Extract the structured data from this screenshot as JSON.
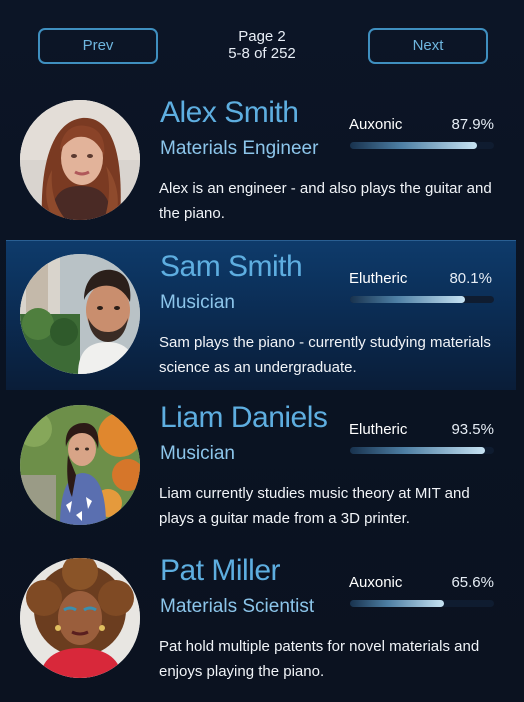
{
  "pagination": {
    "prev_label": "Prev",
    "next_label": "Next",
    "page_label": "Page 2",
    "range_label": "5-8 of 252"
  },
  "people": [
    {
      "name": "Alex Smith",
      "role": "Materials Engineer",
      "skill": "Auxonic",
      "percent_label": "87.9%",
      "percent": 87.9,
      "bio": "Alex is an engineer - and also plays the guitar and the piano.",
      "selected": false
    },
    {
      "name": "Sam Smith",
      "role": "Musician",
      "skill": "Elutheric",
      "percent_label": "80.1%",
      "percent": 80.1,
      "bio": "Sam plays the piano - currently studying materials science as an undergraduate.",
      "selected": true
    },
    {
      "name": "Liam Daniels",
      "role": "Musician",
      "skill": "Elutheric",
      "percent_label": "93.5%",
      "percent": 93.5,
      "bio": "Liam currently studies music theory at MIT and plays a guitar made from a 3D printer.",
      "selected": false
    },
    {
      "name": "Pat Miller",
      "role": "Materials Scientist",
      "skill": "Auxonic",
      "percent_label": "65.6%",
      "percent": 65.6,
      "bio": "Pat hold multiple patents for novel materials and enjoys playing the piano.",
      "selected": false
    }
  ],
  "colors": {
    "background": "#0b1424",
    "accent": "#3f8fbf",
    "name_text": "#5eaee0",
    "role_text": "#8cc5ea",
    "selected_row": "#0e3b6b"
  }
}
